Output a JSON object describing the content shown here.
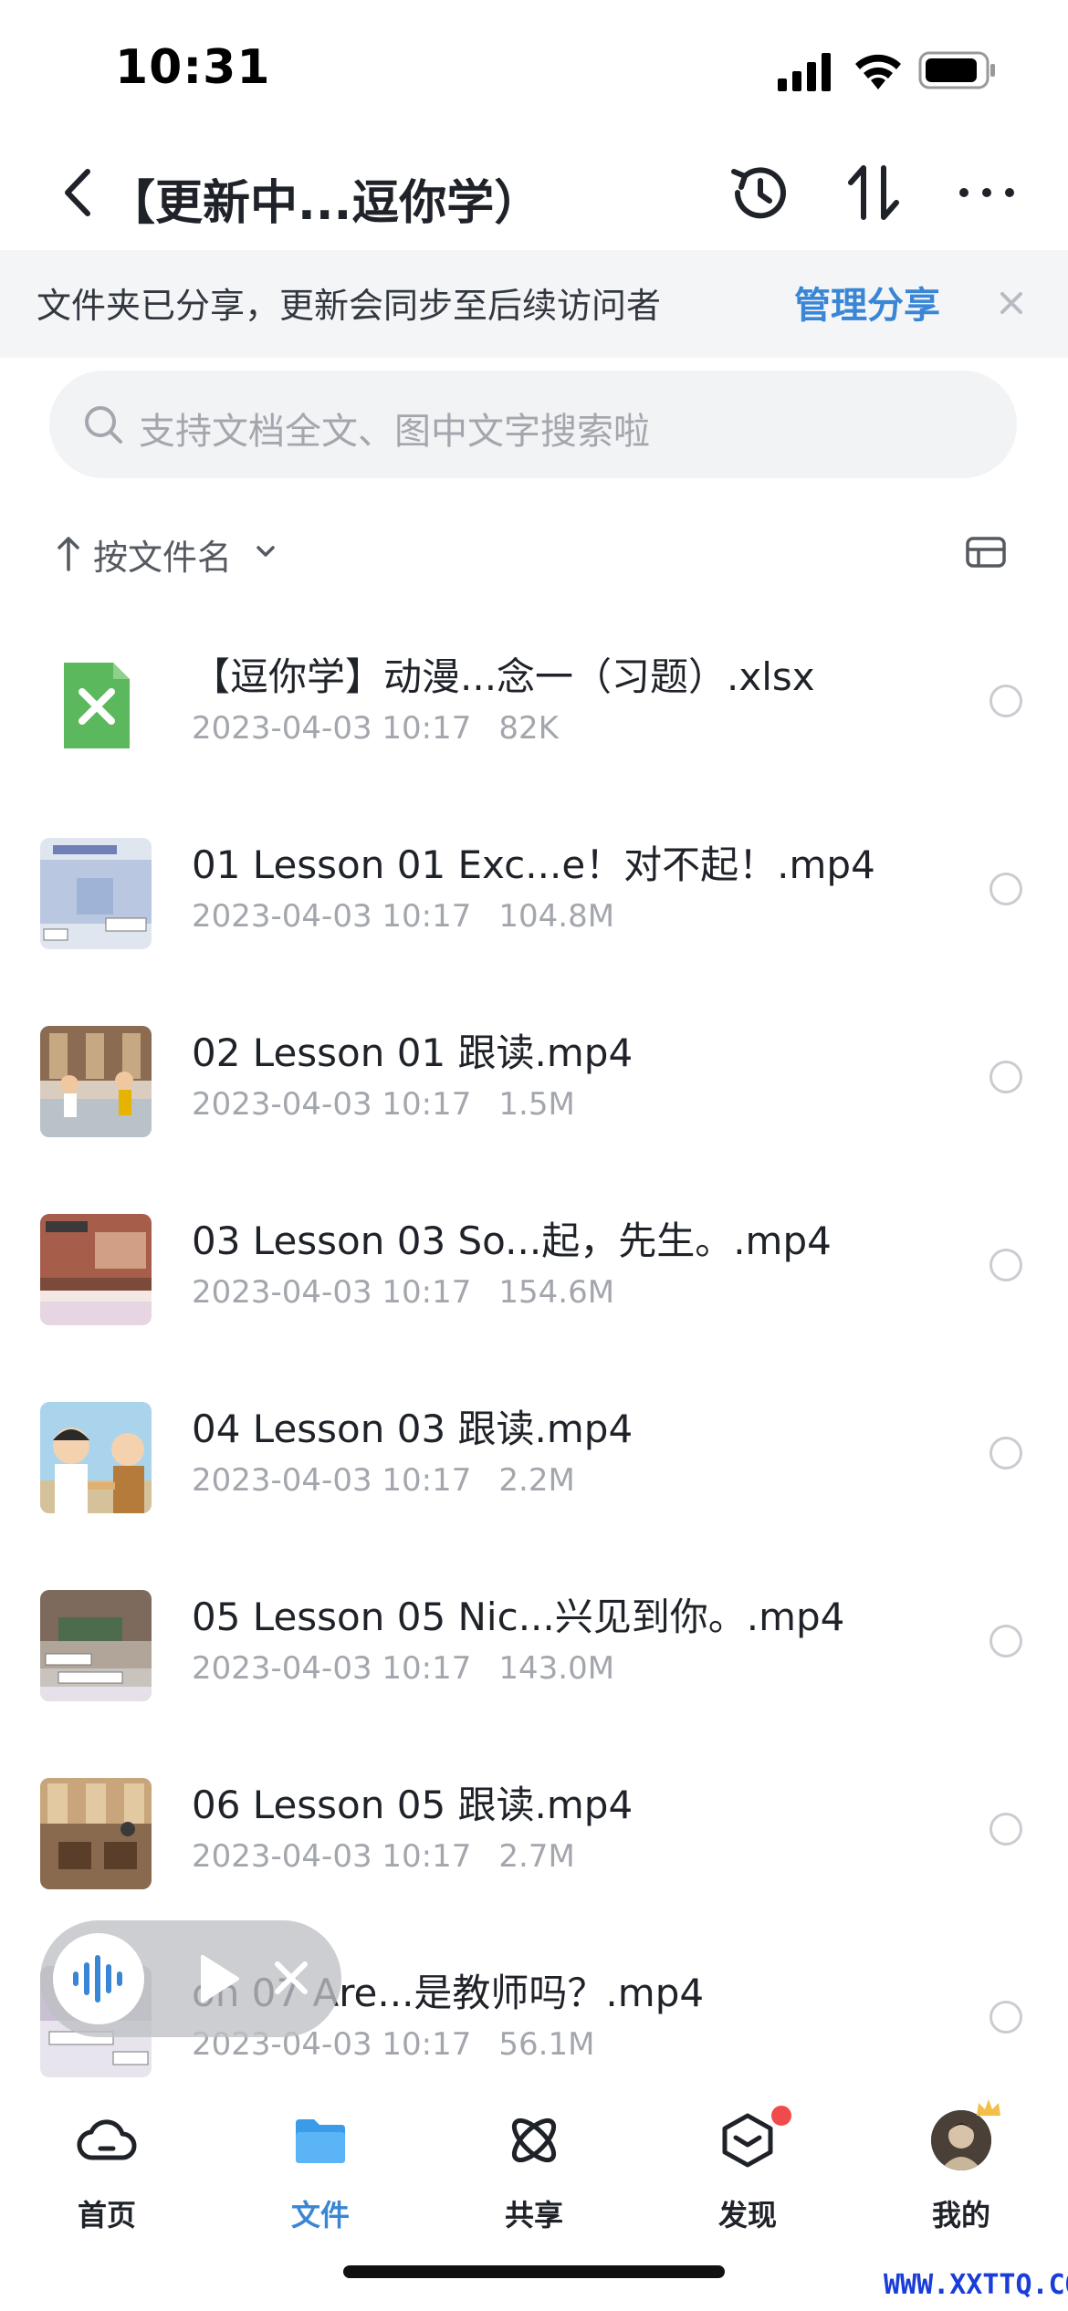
{
  "status_bar": {
    "time": "10:31",
    "icons": [
      "signal-icon",
      "wifi-icon",
      "battery-icon"
    ]
  },
  "nav": {
    "title": "【更新中...逗你学）",
    "icons": [
      "back-icon",
      "history-icon",
      "sort-icon",
      "more-icon"
    ]
  },
  "banner": {
    "text": "文件夹已分享，更新会同步至后续访问者",
    "link": "管理分享",
    "link_color": "#3a86d6"
  },
  "search": {
    "placeholder": "支持文档全文、图中文字搜索啦"
  },
  "sort": {
    "label": "按文件名"
  },
  "files": [
    {
      "name": "【逗你学】动漫...念一（习题）.xlsx",
      "date": "2023-04-03 10:17",
      "size": "82K",
      "thumb": "xlsx-file-icon"
    },
    {
      "name": "01 Lesson 01 Exc...e！对不起！.mp4",
      "date": "2023-04-03 10:17",
      "size": "104.8M",
      "thumb": "video-thumbnail"
    },
    {
      "name": "02 Lesson 01 跟读.mp4",
      "date": "2023-04-03 10:17",
      "size": "1.5M",
      "thumb": "video-thumbnail"
    },
    {
      "name": "03 Lesson 03 So...起，先生。.mp4",
      "date": "2023-04-03 10:17",
      "size": "154.6M",
      "thumb": "video-thumbnail"
    },
    {
      "name": "04 Lesson 03 跟读.mp4",
      "date": "2023-04-03 10:17",
      "size": "2.2M",
      "thumb": "video-thumbnail"
    },
    {
      "name": "05 Lesson 05 Nic...兴见到你。.mp4",
      "date": "2023-04-03 10:17",
      "size": "143.0M",
      "thumb": "video-thumbnail"
    },
    {
      "name": "06 Lesson 05 跟读.mp4",
      "date": "2023-04-03 10:17",
      "size": "2.7M",
      "thumb": "video-thumbnail"
    },
    {
      "name": "07 Lesson 07 Are...是教师吗？.mp4",
      "visible_name": "on 07 Are...是教师吗？.mp4",
      "date": "2023-04-03 10:17",
      "size": "56.1M",
      "thumb": "video-thumbnail"
    }
  ],
  "tabs": [
    {
      "label": "首页",
      "icon": "cloud-icon",
      "active": false
    },
    {
      "label": "文件",
      "icon": "folder-icon",
      "active": true
    },
    {
      "label": "共享",
      "icon": "share-orbit-icon",
      "active": false
    },
    {
      "label": "发现",
      "icon": "discover-cube-icon",
      "active": false,
      "badge": true
    },
    {
      "label": "我的",
      "icon": "avatar",
      "active": false
    }
  ],
  "watermark": "WWW.XXTTQ.COM",
  "colors": {
    "accent": "#3a86d6",
    "badge": "#f04a4a",
    "xlsx_green": "#5cb85c"
  }
}
